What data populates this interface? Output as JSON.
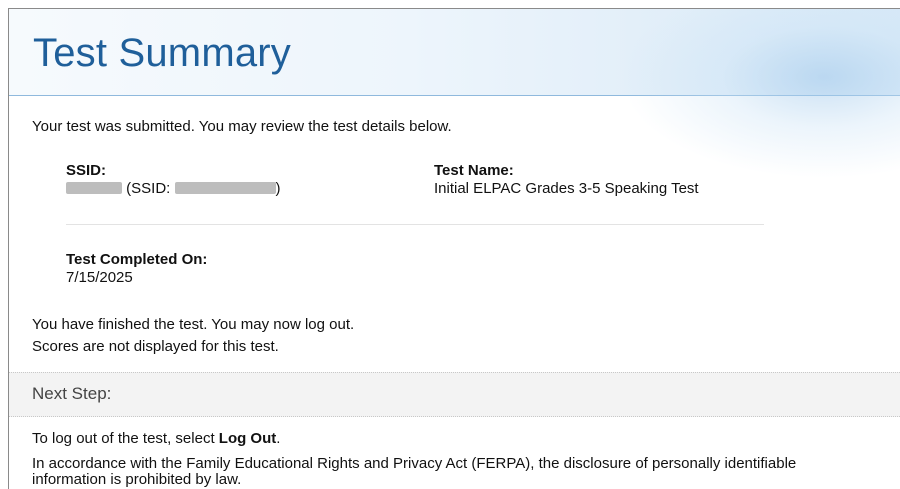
{
  "header": {
    "title": "Test Summary"
  },
  "summary": {
    "intro": "Your test was submitted. You may review the test details below.",
    "ssid_label": "SSID:",
    "ssid_mid": "(SSID:",
    "ssid_close": ")",
    "test_name_label": "Test Name:",
    "test_name_value": "Initial ELPAC Grades 3-5 Speaking Test",
    "completed_label": "Test Completed On:",
    "completed_value": "7/15/2025",
    "finished_line1": "You have finished the test. You may now log out.",
    "finished_line2": "Scores are not displayed for this test."
  },
  "next_step": {
    "heading": "Next Step:",
    "instruction_prefix": "To log out of the test, select ",
    "instruction_bold": "Log Out",
    "instruction_suffix": ".",
    "ferpa_notice": "In accordance with the Family Educational Rights and Privacy Act (FERPA), the disclosure of personally identifiable information is prohibited by law."
  },
  "colors": {
    "title": "#1f5f9a",
    "header_border": "#8fb9dd",
    "next_step_bg": "#f3f3f3",
    "redaction": "#bdbdbd"
  }
}
